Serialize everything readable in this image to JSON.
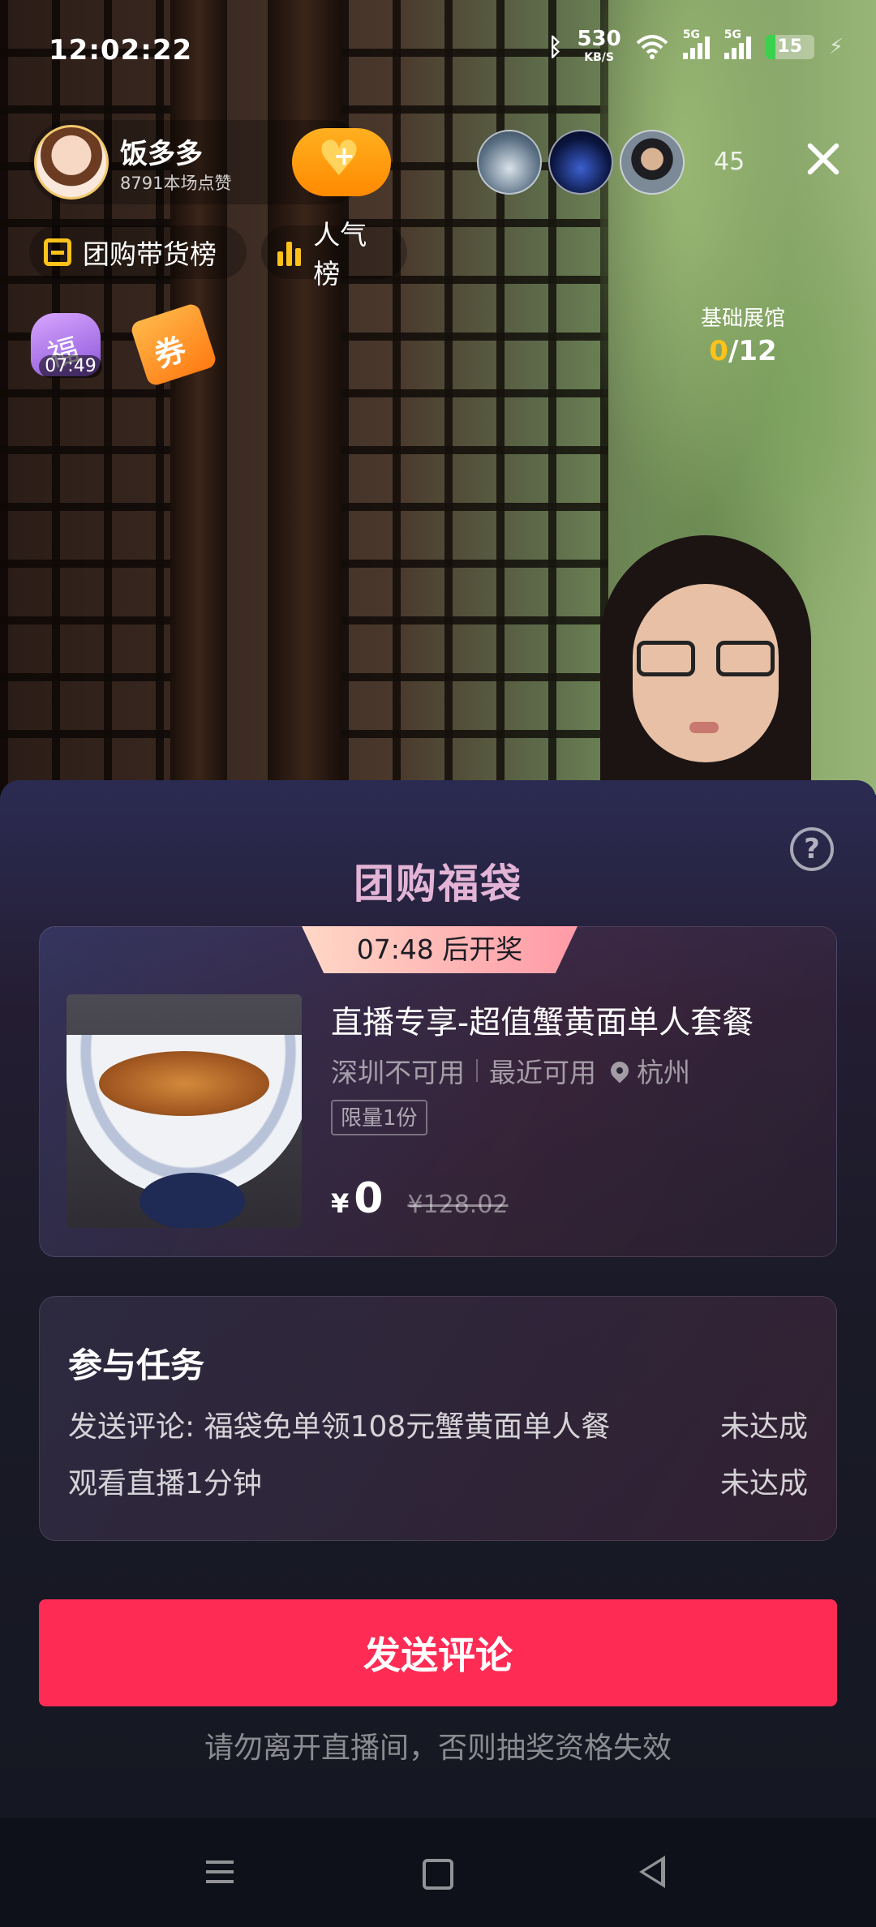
{
  "status_bar": {
    "time": "12:02:22",
    "net_speed": "530",
    "net_unit": "KB/S",
    "sim1": "5G",
    "sim2": "5G",
    "battery": "15"
  },
  "host": {
    "name": "饭多多",
    "likes": "8791本场点赞"
  },
  "viewers": {
    "count": "45"
  },
  "chips": {
    "group_rank": "团购带货榜",
    "popularity_rank": "人气榜"
  },
  "badges": {
    "bag_timer": "07:49",
    "coupon_label": "券"
  },
  "exhibition": {
    "title": "基础展馆",
    "current": "0",
    "total": "/12"
  },
  "sheet": {
    "title": "团购福袋",
    "draw_banner": "07:48 后开奖",
    "product": {
      "name": "直播专享-超值蟹黄面单人套餐",
      "unavailable": "深圳不可用",
      "nearest": "最近可用",
      "city": "杭州",
      "limit": "限量1份",
      "currency": "¥",
      "price": "0",
      "original_price": "¥128.02"
    },
    "tasks": {
      "title": "参与任务",
      "items": [
        {
          "label": "发送评论: 福袋免单领108元蟹黄面单人餐",
          "status": "未达成"
        },
        {
          "label": "观看直播1分钟",
          "status": "未达成"
        }
      ]
    },
    "cta_label": "发送评论",
    "warning": "请勿离开直播间，否则抽奖资格失效"
  },
  "colors": {
    "accent": "#fe2c55",
    "gold": "#ffc21a"
  },
  "icons": [
    "bluetooth-icon",
    "wifi-icon",
    "signal-icon",
    "battery-icon",
    "follow-heart-icon",
    "close-icon",
    "bag-icon",
    "bar-chart-icon",
    "help-icon",
    "location-pin-icon",
    "menu-icon",
    "home-icon",
    "back-icon"
  ]
}
